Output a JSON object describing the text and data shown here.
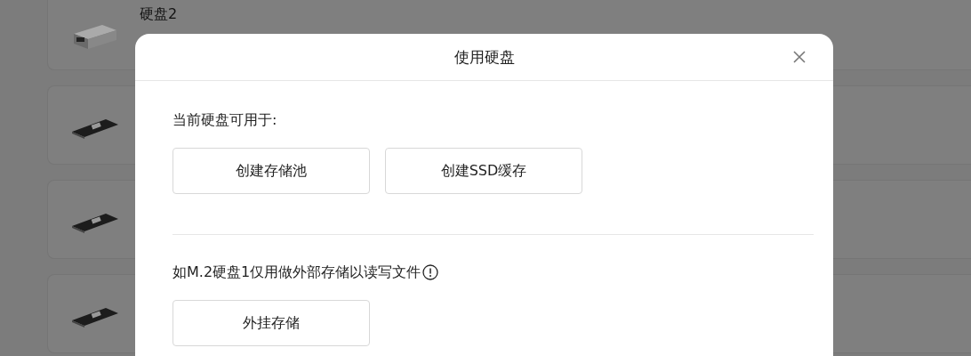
{
  "disks": [
    {
      "kind": "hdd",
      "name": "硬盘2"
    },
    {
      "kind": "m2"
    },
    {
      "kind": "m2"
    },
    {
      "kind": "m2"
    }
  ],
  "dialog": {
    "title": "使用硬盘",
    "sections": [
      {
        "label": "当前硬盘可用于:",
        "info": false,
        "buttons": [
          "创建存储池",
          "创建SSD缓存"
        ]
      },
      {
        "label": "如M.2硬盘1仅用做外部存储以读写文件",
        "info": true,
        "buttons": [
          "外挂存储"
        ]
      }
    ]
  }
}
